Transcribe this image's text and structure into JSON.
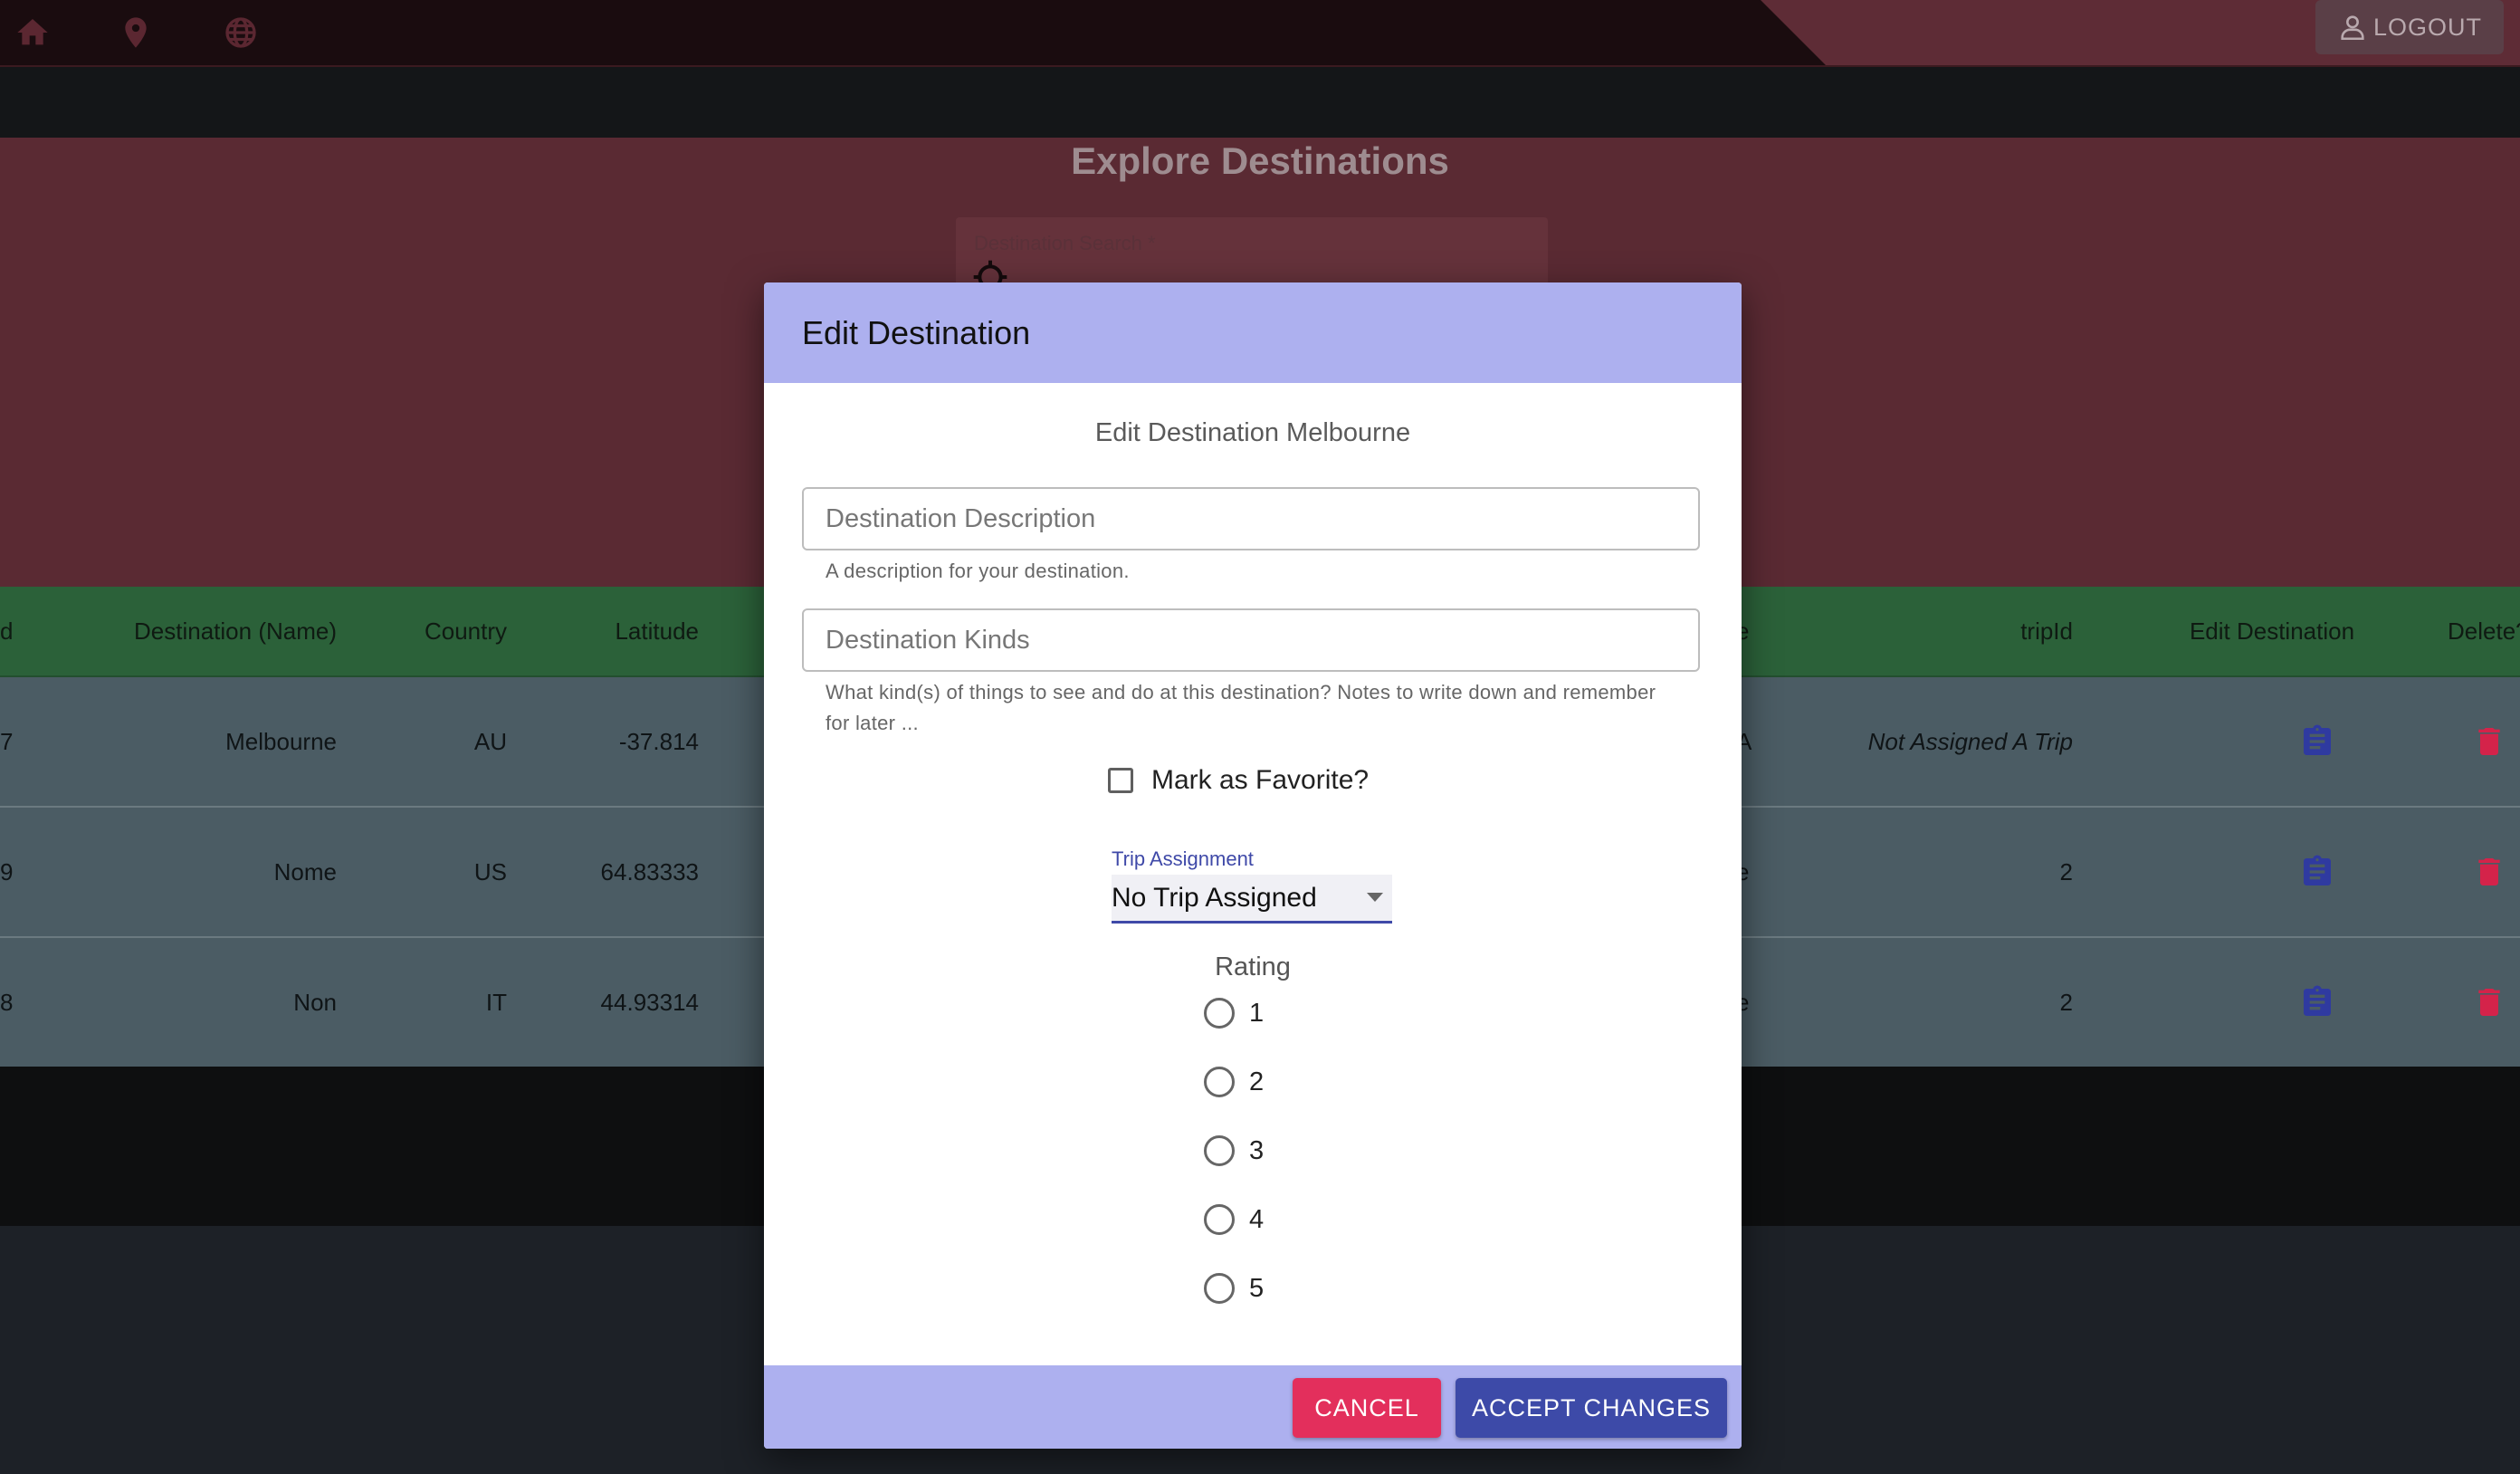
{
  "topbar": {
    "nav_icons": [
      "home-icon",
      "map-pin-icon",
      "globe-icon"
    ],
    "logout_label": "LOGOUT"
  },
  "explore": {
    "title": "Explore Destinations",
    "search_label": "Destination Search *"
  },
  "table": {
    "headers": {
      "id": "d",
      "name": "Destination (Name)",
      "country": "Country",
      "latitude": "Latitude",
      "partial": "e",
      "trip_id": "tripId",
      "edit": "Edit Destination",
      "delete": "Delete?"
    },
    "rows": [
      {
        "id": "7",
        "name": "Melbourne",
        "country": "AU",
        "latitude": "-37.814",
        "partial": "A",
        "trip_id": "Not Assigned A Trip"
      },
      {
        "id": "9",
        "name": "Nome",
        "country": "US",
        "latitude": "64.83333",
        "partial": "e",
        "trip_id": "2"
      },
      {
        "id": "8",
        "name": "Non",
        "country": "IT",
        "latitude": "44.93314",
        "partial": "e",
        "trip_id": "2"
      }
    ]
  },
  "modal": {
    "title": "Edit Destination",
    "subtitle": "Edit Destination Melbourne",
    "description_placeholder": "Destination Description",
    "description_helper": "A description for your destination.",
    "kinds_placeholder": "Destination Kinds",
    "kinds_helper": "What kind(s) of things to see and do at this destination? Notes to write down and remember for later ...",
    "favorite_label": "Mark as Favorite?",
    "trip_label": "Trip Assignment",
    "trip_value": "No Trip Assigned",
    "rating_label": "Rating",
    "rating_options": [
      "1",
      "2",
      "3",
      "4",
      "5"
    ],
    "cancel_label": "CANCEL",
    "accept_label": "ACCEPT CHANGES"
  },
  "colors": {
    "modal_header": "#adb0ef",
    "cancel": "#e32f5c",
    "accept": "#3d4aa8",
    "edit_icon": "#2f3aa0",
    "delete_icon": "#d4234a",
    "table_header": "#2b6139"
  }
}
